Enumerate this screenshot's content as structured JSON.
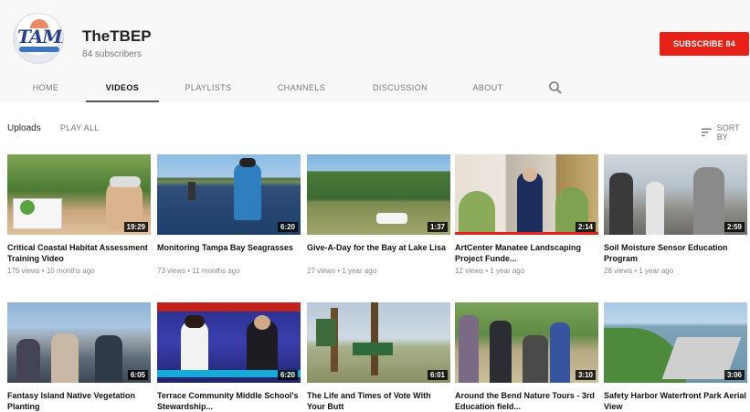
{
  "channel": {
    "logo_text": "TAMPA",
    "name": "TheTBEP",
    "subscribers": "84 subscribers",
    "subscribe_label": "SUBSCRIBE  84",
    "accent_color": "#e62117"
  },
  "tabs": [
    {
      "label": "HOME",
      "active": false
    },
    {
      "label": "VIDEOS",
      "active": true
    },
    {
      "label": "PLAYLISTS",
      "active": false
    },
    {
      "label": "CHANNELS",
      "active": false
    },
    {
      "label": "DISCUSSION",
      "active": false
    },
    {
      "label": "ABOUT",
      "active": false
    }
  ],
  "search_icon": "search-icon",
  "uploads": {
    "label": "Uploads",
    "play_all": "PLAY ALL",
    "sort_label": "SORT BY",
    "sort_icon": "sort-icon"
  },
  "videos": [
    {
      "title": "Critical Coastal Habitat Assessment Training Video",
      "meta": "175 views • 10 months ago",
      "duration": "19:29"
    },
    {
      "title": "Monitoring Tampa Bay Seagrasses",
      "meta": "73 views • 11 months ago",
      "duration": "6:20"
    },
    {
      "title": "Give-A-Day for the Bay at Lake Lisa",
      "meta": "27 views • 1 year ago",
      "duration": "1:37"
    },
    {
      "title": "ArtCenter Manatee Landscaping Project Funde...",
      "meta": "12 views • 1 year ago",
      "duration": "2:14"
    },
    {
      "title": "Soil Moisture Sensor Education Program",
      "meta": "28 views • 1 year ago",
      "duration": "2:59"
    },
    {
      "title": "Fantasy Island Native Vegetation Planting",
      "meta": "",
      "duration": "6:05"
    },
    {
      "title": "Terrace Community Middle School's Stewardship...",
      "meta": "",
      "duration": "6:20"
    },
    {
      "title": "The Life and Times of Vote With Your Butt",
      "meta": "",
      "duration": "6:01"
    },
    {
      "title": "Around the Bend Nature Tours - 3rd Education field...",
      "meta": "",
      "duration": "3:10"
    },
    {
      "title": "Safety Harbor Waterfront Park Aerial View",
      "meta": "",
      "duration": "3:06"
    }
  ]
}
